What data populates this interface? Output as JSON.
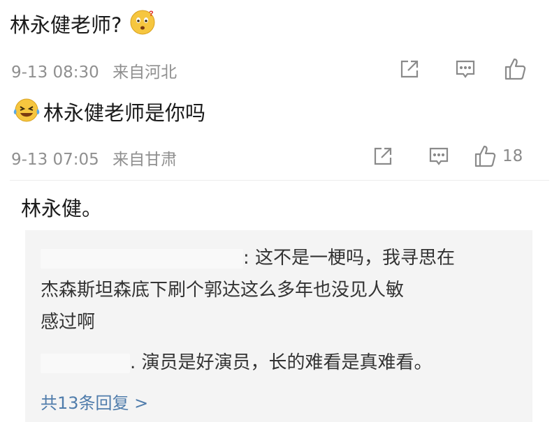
{
  "comments": [
    {
      "text": "林永健老师?",
      "emoji": "thinking-face-emoji",
      "time": "9-13 08:30",
      "location": "来自河北",
      "like_count": ""
    },
    {
      "text": "林永健老师是你吗",
      "emoji": "laughing-crying-face-emoji",
      "time": "9-13 07:05",
      "location": "来自甘肃",
      "like_count": "18"
    }
  ],
  "reply": {
    "text": "林永健。",
    "sub_replies": [
      {
        "text_line1": ": 这不是一梗吗，我寻思在",
        "text_line2": "杰森斯坦森底下刷个郭达这么多年也没见人敏",
        "text_line3": "感过啊"
      },
      {
        "text": ". 演员是好演员，长的难看是真难看。"
      }
    ],
    "more_label": "共13条回复 >"
  },
  "colors": {
    "meta": "#8f8f8f",
    "link": "#4f7cab",
    "subbox_bg": "#f4f4f4"
  },
  "icons": [
    "share-icon",
    "comment-icon",
    "thumbs-up-icon"
  ]
}
